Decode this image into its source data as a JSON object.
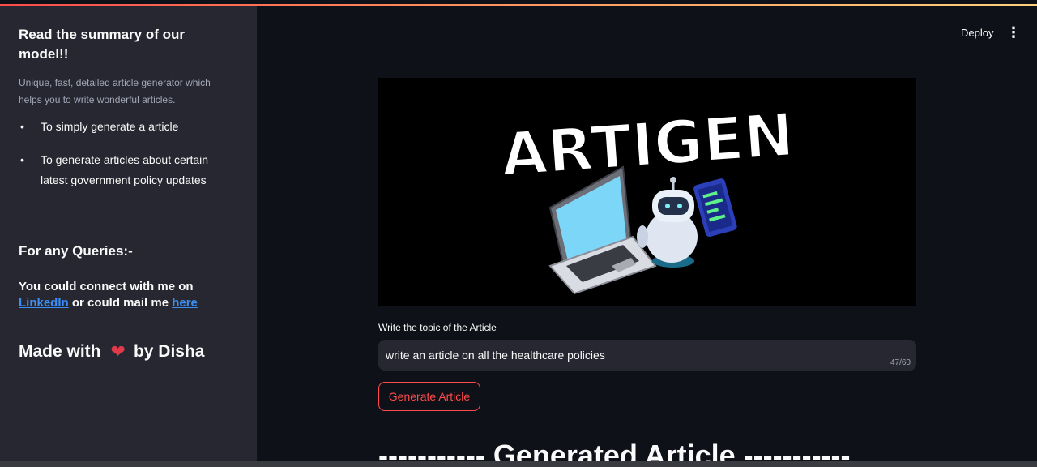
{
  "header": {
    "deploy_label": "Deploy",
    "menu_glyph": "⋮"
  },
  "sidebar": {
    "title": "Read the summary of our model!!",
    "description": "Unique, fast, detailed article generator which helps you to write wonderful articles.",
    "bullets": [
      "To simply generate a article",
      "To generate articles about certain latest government policy updates"
    ],
    "queries_heading": "For any Queries:-",
    "connect_prefix": "You could connect with me on",
    "linkedin_label": "LinkedIn",
    "connect_middle": "or could mail me",
    "mail_label": "here",
    "made_with_prefix": "Made with",
    "made_with_suffix": "by Disha"
  },
  "main": {
    "hero_logo_text": "ARTIGEN",
    "input_label": "Write the topic of the Article",
    "input_value": "write an article on all the healthcare policies",
    "char_count": "47/60",
    "generate_button": "Generate Article",
    "generated_heading": "----------- Generated Article -----------"
  },
  "colors": {
    "accent": "#ff4b4b",
    "link": "#3b8ff6",
    "sidebar_bg": "#262730",
    "main_bg": "#0e1117"
  }
}
